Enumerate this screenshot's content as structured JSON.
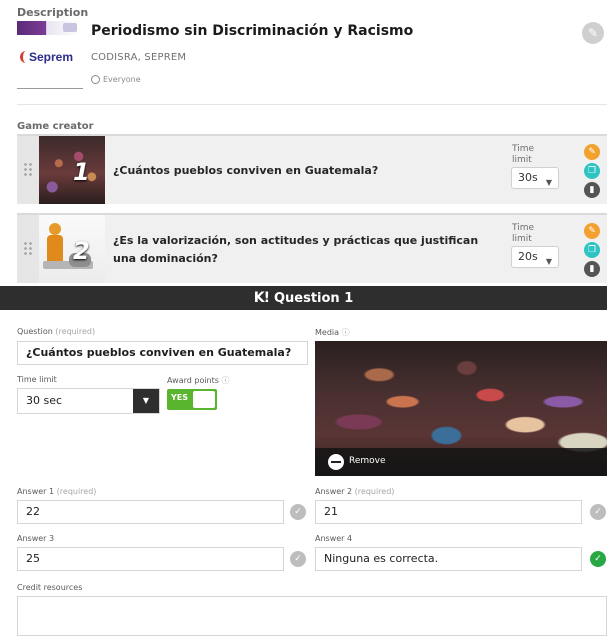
{
  "description": {
    "section_label": "Description",
    "title": "Periodismo sin Discriminación y Racismo",
    "logo_text": "Seprem",
    "authors": "CODISRA, SEPREM",
    "visibility": "Everyone"
  },
  "game_creator": {
    "section_label": "Game creator",
    "time_limit_label": "Time limit",
    "questions": [
      {
        "number": "1",
        "text": "¿Cuántos pueblos conviven en Guatemala?",
        "time_limit": "30s"
      },
      {
        "number": "2",
        "text": "¿Es la valorización, son actitudes y prácticas que justifican una dominación?",
        "time_limit": "20s"
      }
    ]
  },
  "editor": {
    "header_logo": "K!",
    "header_title": "Question 1",
    "question_label": "Question",
    "question_required": "(required)",
    "question_value": "¿Cuántos pueblos conviven en Guatemala?",
    "media_label": "Media",
    "time_limit_label": "Time limit",
    "time_limit_value": "30 sec",
    "award_points_label": "Award points",
    "award_points_toggle": "YES",
    "remove_label": "Remove",
    "answers": [
      {
        "label": "Answer 1",
        "required": "(required)",
        "value": "22",
        "correct": false
      },
      {
        "label": "Answer 2",
        "required": "(required)",
        "value": "21",
        "correct": false
      },
      {
        "label": "Answer 3",
        "required": "",
        "value": "25",
        "correct": false
      },
      {
        "label": "Answer 4",
        "required": "",
        "value": "Ninguna es correcta.",
        "correct": true
      }
    ],
    "credit_label": "Credit resources",
    "credit_value": ""
  },
  "colors": {
    "header_bar": "#2e2e2e",
    "toggle_on": "#5ab52e",
    "edit_action": "#f2a12e",
    "duplicate_action": "#2ec4c4",
    "delete_action": "#555555",
    "correct_check": "#27a844"
  },
  "icons": [
    "pencil-icon",
    "duplicate-icon",
    "trash-icon",
    "drag-handle-icon",
    "globe-icon",
    "info-icon",
    "chevron-down-icon",
    "minus-circle-icon",
    "check-icon"
  ]
}
